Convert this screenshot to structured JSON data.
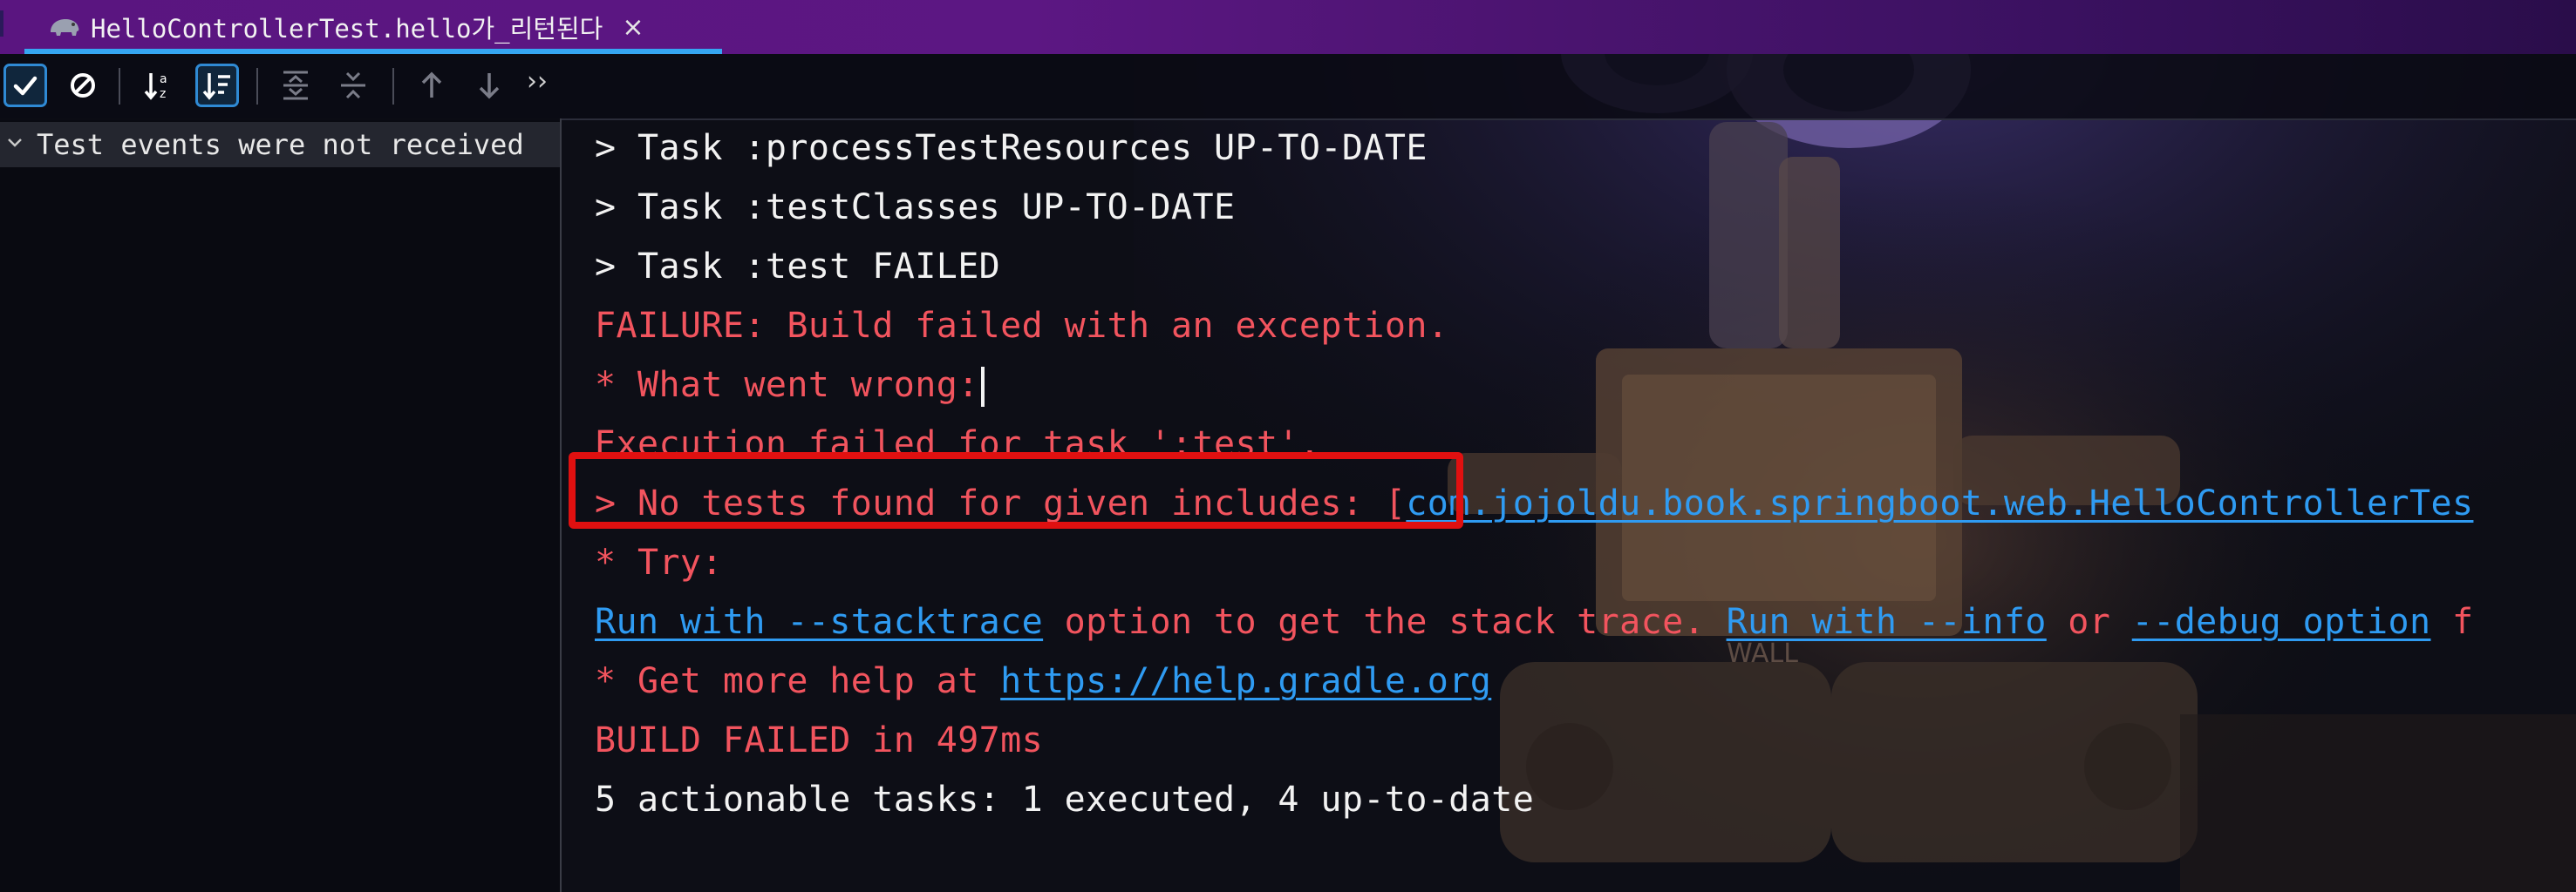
{
  "tab": {
    "title": "HelloControllerTest.hello가_리턴된다",
    "icon": "gradle-elephant-icon",
    "close_glyph": "×"
  },
  "toolbar": {
    "buttons": [
      {
        "name": "show-passed-toggle",
        "icon": "check-icon",
        "active": true
      },
      {
        "name": "show-ignored-toggle",
        "icon": "ban-icon",
        "active": false
      },
      {
        "name": "sort-alphabetically-button",
        "icon": "sort-alpha-icon",
        "active": false
      },
      {
        "name": "sort-by-duration-button",
        "icon": "sort-duration-icon",
        "active": true
      },
      {
        "name": "expand-all-button",
        "icon": "expand-all-icon",
        "active": false
      },
      {
        "name": "collapse-all-button",
        "icon": "collapse-all-icon",
        "active": false
      },
      {
        "name": "previous-failed-button",
        "icon": "arrow-up-icon",
        "active": false
      },
      {
        "name": "next-failed-button",
        "icon": "arrow-down-icon",
        "active": false
      }
    ],
    "more_glyph": "››"
  },
  "tree": {
    "root_label": "Test events were not received"
  },
  "console": {
    "lines": [
      "> Task :processTestResources UP-TO-DATE",
      "> Task :testClasses UP-TO-DATE",
      "> Task :test FAILED",
      "FAILURE: Build failed with an exception.",
      "* What went wrong:",
      "Execution failed for task ':test'.",
      "> No tests found for given includes: [",
      "com.jojoldu.book.springboot.web.HelloControllerTes",
      "* Try:",
      "Run with --stacktrace",
      " option to get the stack trace. ",
      "Run with --info",
      " or ",
      "--debug option",
      " f",
      "* Get more help at ",
      "https://help.gradle.org",
      "BUILD FAILED in 497ms",
      "5 actionable tasks: 1 executed, 4 up-to-date"
    ]
  },
  "colors": {
    "normal_text": "#f2f2f2",
    "error_text": "#f2545e",
    "link": "#2f9bf2",
    "highlight_box": "#e01010",
    "tab_underline": "#35a6f2"
  }
}
